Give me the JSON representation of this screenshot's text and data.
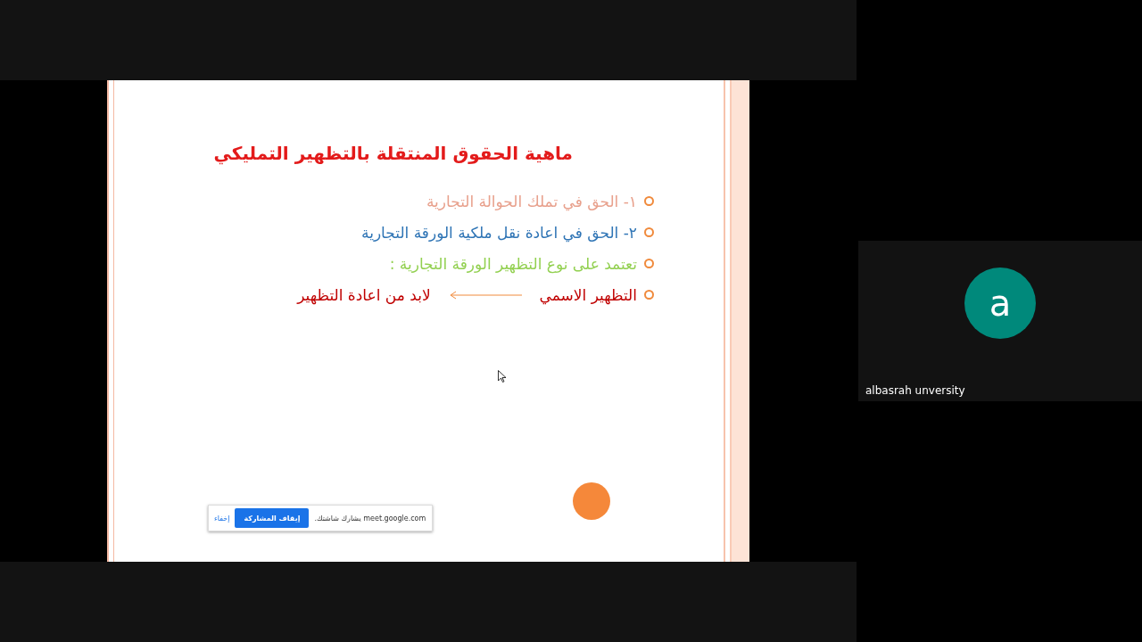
{
  "slide": {
    "title": "ماهية الحقوق المنتقلة بالتظهير التمليكي",
    "bullets": [
      {
        "kind": "text",
        "text": "١- الحق في تملك الحوالة التجارية",
        "color": "#e8a08c"
      },
      {
        "kind": "text",
        "text": "٢- الحق في اعادة نقل ملكية الورقة التجارية",
        "color": "#2e74b5"
      },
      {
        "kind": "text",
        "text": "تعتمد على نوع التظهير الورقة التجارية :",
        "color": "#92d050"
      },
      {
        "kind": "arrow",
        "text": "التظهير الاسمي",
        "result": "لابد من اعادة التظهير",
        "color": "#c00000"
      }
    ]
  },
  "share_bar": {
    "message": "meet.google.com يشارك شاشتك.",
    "stop_button": "إيقاف المشاركة",
    "hide_link": "إخفاء"
  },
  "participant": {
    "initial": "a",
    "name": "albasrah unversity"
  }
}
